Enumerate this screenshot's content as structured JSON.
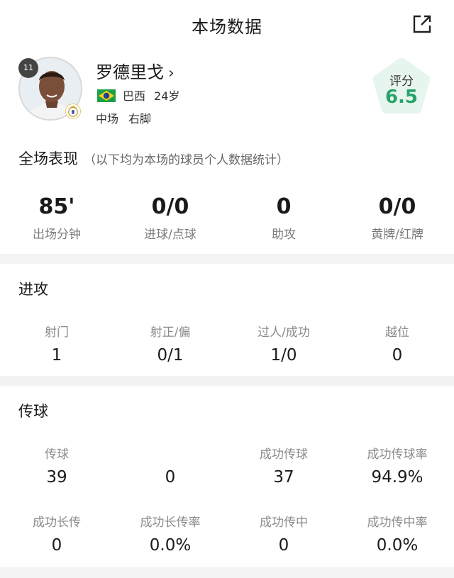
{
  "header": {
    "title": "本场数据",
    "share_icon": "share-icon"
  },
  "player": {
    "number": "11",
    "name": "罗德里戈",
    "chevron": "›",
    "nationality": "巴西",
    "age": "24岁",
    "position": "中场",
    "foot": "右脚",
    "flag_icon": "brazil-flag-icon"
  },
  "rating": {
    "label": "评分",
    "value": "6.5",
    "color": "#27a36a",
    "bg": "#e6f6ee"
  },
  "overall": {
    "title": "全场表现",
    "note": "（以下均为本场的球员个人数据统计）",
    "stats": [
      {
        "value": "85'",
        "label": "出场分钟"
      },
      {
        "value": "0/0",
        "label": "进球/点球"
      },
      {
        "value": "0",
        "label": "助攻"
      },
      {
        "value": "0/0",
        "label": "黄牌/红牌"
      }
    ]
  },
  "attack": {
    "title": "进攻",
    "stats": [
      {
        "label": "射门",
        "value": "1"
      },
      {
        "label": "射正/偏",
        "value": "0/1"
      },
      {
        "label": "过人/成功",
        "value": "1/0"
      },
      {
        "label": "越位",
        "value": "0"
      }
    ]
  },
  "passing": {
    "title": "传球",
    "row1": [
      {
        "label": "传球",
        "value": "39"
      },
      {
        "label": "",
        "value": "0"
      },
      {
        "label": "成功传球",
        "value": "37"
      },
      {
        "label": "成功传球率",
        "value": "94.9%"
      }
    ],
    "row2": [
      {
        "label": "成功长传",
        "value": "0"
      },
      {
        "label": "成功长传率",
        "value": "0.0%"
      },
      {
        "label": "成功传中",
        "value": "0"
      },
      {
        "label": "成功传中率",
        "value": "0.0%"
      }
    ]
  }
}
